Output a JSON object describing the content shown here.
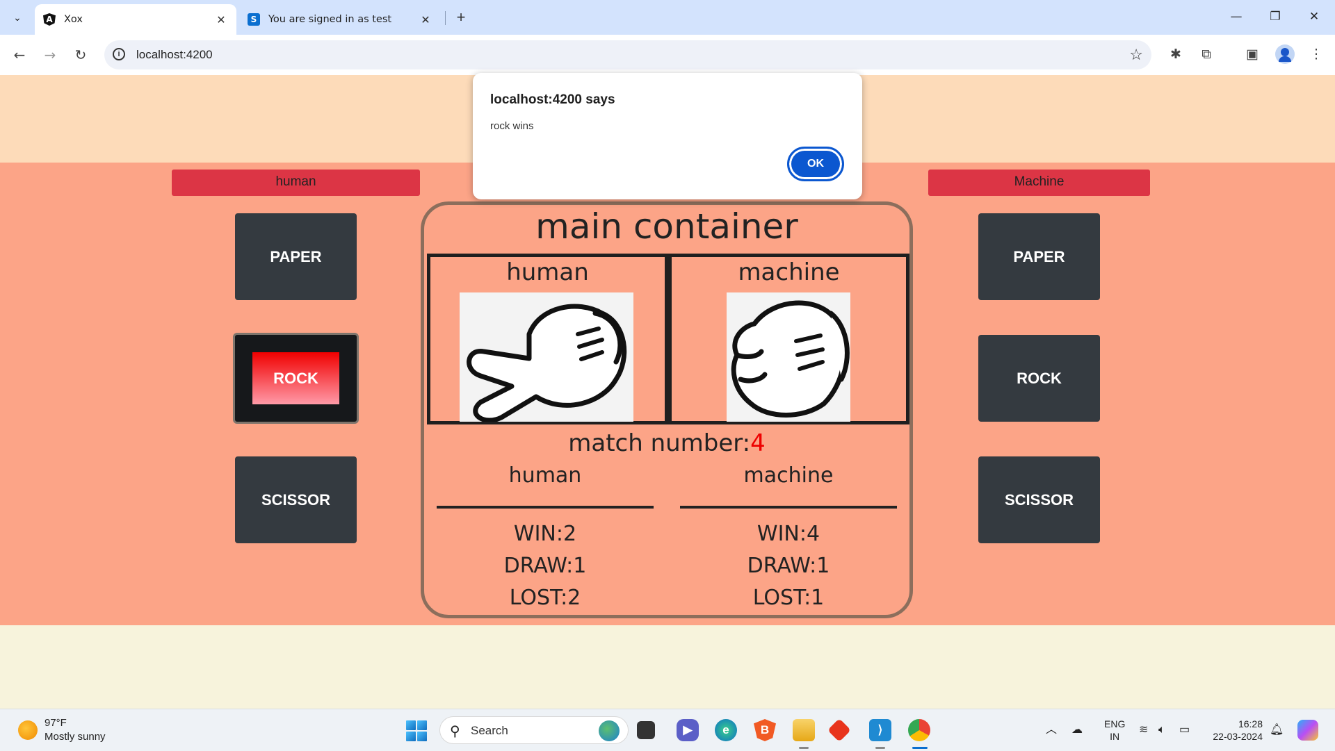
{
  "browser": {
    "tabs": [
      {
        "title": "Xox",
        "favicon": "angular-icon",
        "active": true
      },
      {
        "title": "You are signed in as test",
        "favicon": "s-icon",
        "active": false
      }
    ],
    "url": "localhost:4200"
  },
  "page": {
    "left_label": "human",
    "right_label": "Machine",
    "left_choices": [
      "PAPER",
      "ROCK",
      "SCISSOR"
    ],
    "right_choices": [
      "PAPER",
      "ROCK",
      "SCISSOR"
    ],
    "selected_left": "ROCK",
    "main_title": "main container",
    "human_panel_title": "human",
    "machine_panel_title": "machine",
    "match_label": "match number:",
    "match_number": "4",
    "stats": {
      "human": {
        "header": "human",
        "win": "WIN:2",
        "draw": "DRAW:1",
        "lost": "LOST:2"
      },
      "machine": {
        "header": "machine",
        "win": "WIN:4",
        "draw": "DRAW:1",
        "lost": "LOST:1"
      }
    }
  },
  "alert": {
    "title": "localhost:4200 says",
    "message": "rock wins",
    "ok_label": "OK"
  },
  "taskbar": {
    "weather_temp": "97°F",
    "weather_desc": "Mostly sunny",
    "search_label": "Search",
    "lang_top": "ENG",
    "lang_bottom": "IN",
    "time": "16:28",
    "date": "22-03-2024"
  },
  "colors": {
    "page_top": "#fddbb9",
    "page_main": "#fca487",
    "label_red": "#dc3545",
    "button_dark": "#343a40",
    "match_number": "#e00000",
    "alert_ok": "#0b57d0"
  }
}
